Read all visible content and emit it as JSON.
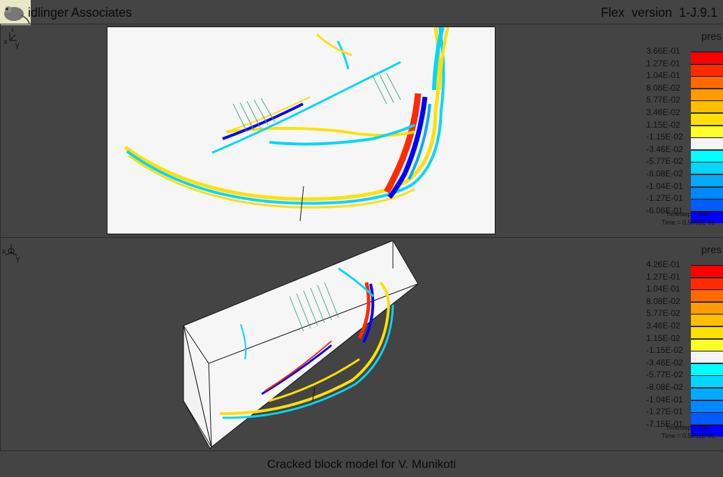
{
  "header": {
    "company": "idlinger Associates",
    "version": "Flex  version  1-J.9.1"
  },
  "views": {
    "top_axis": "x",
    "top_axis2": "y",
    "bottom_axis": "x",
    "bottom_axis2": "y"
  },
  "legend_top": {
    "title": "pres",
    "labels": [
      "3.66E-01",
      "1.27E-01",
      "1.04E-01",
      "8.08E-02",
      "5.77E-02",
      "3.46E-02",
      "1.15E-02",
      "-1.15E-02",
      "-3.46E-02",
      "-5.77E-02",
      "-8.08E-02",
      "-1.04E-01",
      "-1.27E-01",
      "-6.06E-01"
    ],
    "timestep": "Timestep = 330",
    "time": "Time = 0.5092E-05"
  },
  "legend_bottom": {
    "title": "pres",
    "labels": [
      "4.26E-01",
      "1.27E-01",
      "1.04E-01",
      "8.08E-02",
      "5.77E-02",
      "3.46E-02",
      "1.15E-02",
      "-1.15E-02",
      "-3.46E-02",
      "-5.77E-02",
      "-8.08E-02",
      "-1.04E-01",
      "-1.27E-01",
      "-7.15E-01"
    ],
    "timestep": "Timestep = 330",
    "time": "Time = 0.5092E-05"
  },
  "colors": {
    "bands": [
      "#ff0000",
      "#ff2a00",
      "#ff6a00",
      "#ff9a00",
      "#ffbf00",
      "#ffe000",
      "#ffff2a",
      "#f4f4f4",
      "#00ffff",
      "#00d6ff",
      "#00aaff",
      "#0088ff",
      "#005cff",
      "#0000ff"
    ],
    "background": "#444444",
    "panel": "#f6f6f6"
  },
  "footer": {
    "caption": "Cracked block model for V. Munikoti"
  }
}
